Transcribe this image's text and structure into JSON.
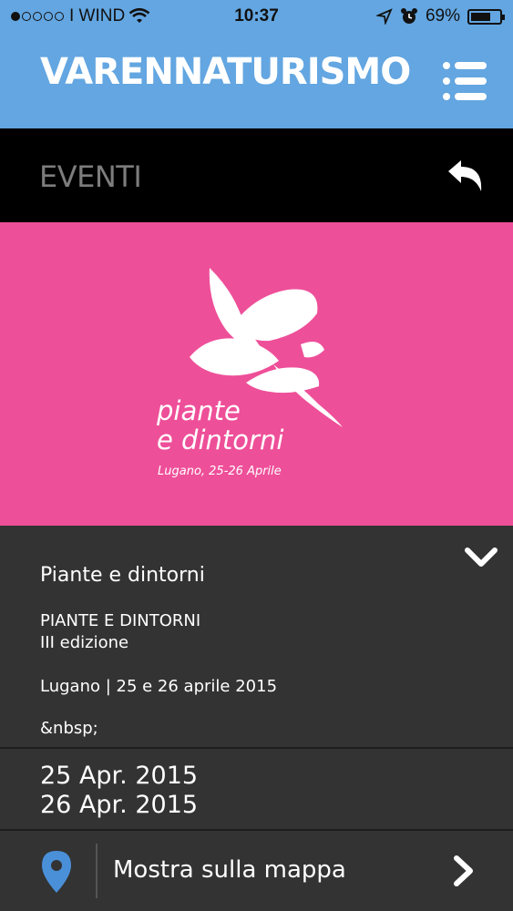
{
  "status_bar": {
    "carrier": "I WIND",
    "time": "10:37",
    "battery": "69%",
    "battery_level": 0.69,
    "signal_bars": 1,
    "signal_total": 5
  },
  "header": {
    "brand": "VARENNATURISMO",
    "menu_icon": "hamburger-list-icon"
  },
  "section": {
    "title": "EVENTI",
    "back_icon": "reply-arrow-icon"
  },
  "hero": {
    "background_color": "#ee4f99",
    "title_line1": "piante",
    "title_line2": "e dintorni",
    "subtitle": "Lugano, 25-26 Aprile"
  },
  "event": {
    "heading": "Piante e dintorni",
    "lines": [
      "PIANTE E DINTORNI",
      "III edizione",
      "Lugano | 25 e 26 aprile 2015",
      "&nbsp;"
    ],
    "expand_icon": "chevron-down-icon"
  },
  "dates": [
    "25 Apr. 2015",
    "26 Apr. 2015"
  ],
  "map_row": {
    "label": "Mostra sulla mappa",
    "pin_color": "#4a90d9"
  },
  "colors": {
    "header_bg": "#63a6e1",
    "section_bg": "#000000",
    "content_bg": "#333333"
  }
}
